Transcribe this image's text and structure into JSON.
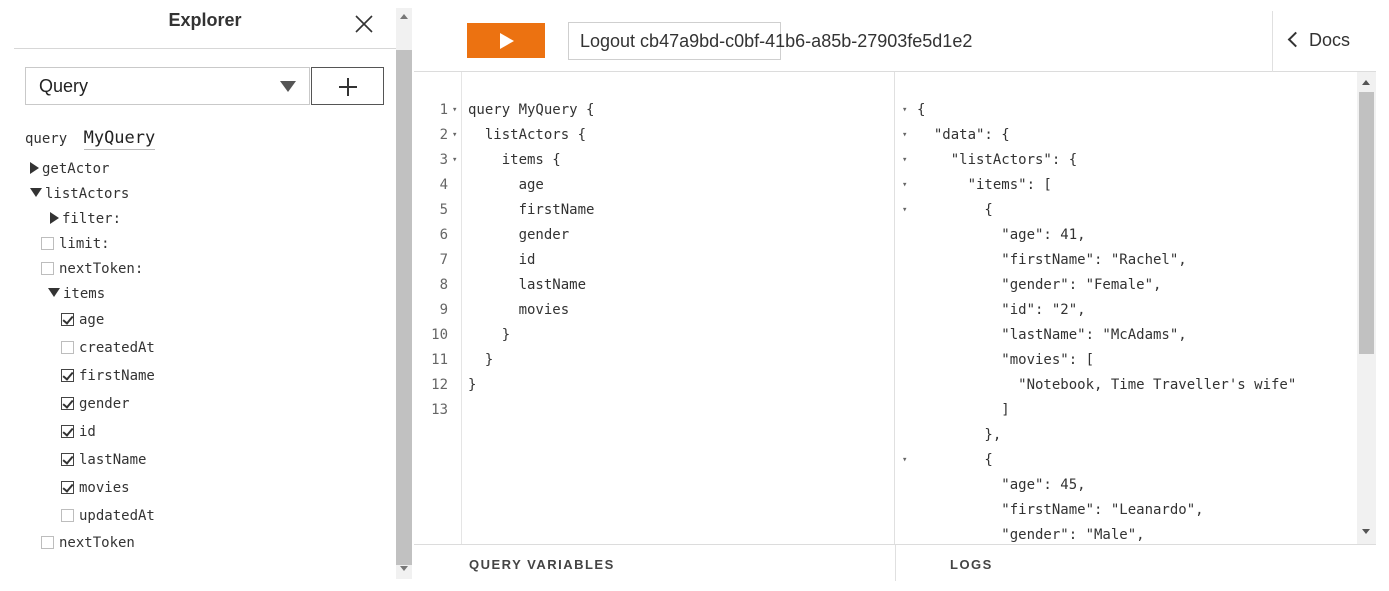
{
  "explorer": {
    "title": "Explorer",
    "operation_type": "Query",
    "operation_kind": "query",
    "operation_name": "MyQuery",
    "tree": {
      "getActor": "getActor",
      "listActors": "listActors",
      "filter": "filter:",
      "limit": "limit:",
      "nextToken_arg": "nextToken:",
      "items": "items",
      "fields": [
        {
          "label": "age",
          "checked": true
        },
        {
          "label": "createdAt",
          "checked": false
        },
        {
          "label": "firstName",
          "checked": true
        },
        {
          "label": "gender",
          "checked": true
        },
        {
          "label": "id",
          "checked": true
        },
        {
          "label": "lastName",
          "checked": true
        },
        {
          "label": "movies",
          "checked": true
        },
        {
          "label": "updatedAt",
          "checked": false
        }
      ],
      "nextToken_field": "nextToken"
    }
  },
  "toolbar": {
    "logout_label": "Logout cb47a9bd-c0bf-41b6-a85b-27903fe5d1e2",
    "docs_label": "Docs",
    "run_color": "#ec7211"
  },
  "query_editor": {
    "line_numbers": [
      "1",
      "2",
      "3",
      "4",
      "5",
      "6",
      "7",
      "8",
      "9",
      "10",
      "11",
      "12",
      "13"
    ],
    "lines": [
      "query MyQuery {",
      "  listActors {",
      "    items {",
      "      age",
      "      firstName",
      "      gender",
      "      id",
      "      lastName",
      "      movies",
      "    }",
      "  }",
      "}",
      ""
    ]
  },
  "result": {
    "lines": [
      "{",
      "  \"data\": {",
      "    \"listActors\": {",
      "      \"items\": [",
      "        {",
      "          \"age\": 41,",
      "          \"firstName\": \"Rachel\",",
      "          \"gender\": \"Female\",",
      "          \"id\": \"2\",",
      "          \"lastName\": \"McAdams\",",
      "          \"movies\": [",
      "            \"Notebook, Time Traveller's wife\"",
      "          ]",
      "        },",
      "        {",
      "          \"age\": 45,",
      "          \"firstName\": \"Leanardo\",",
      "          \"gender\": \"Male\","
    ]
  },
  "bottom": {
    "query_variables_label": "QUERY VARIABLES",
    "logs_label": "LOGS"
  }
}
